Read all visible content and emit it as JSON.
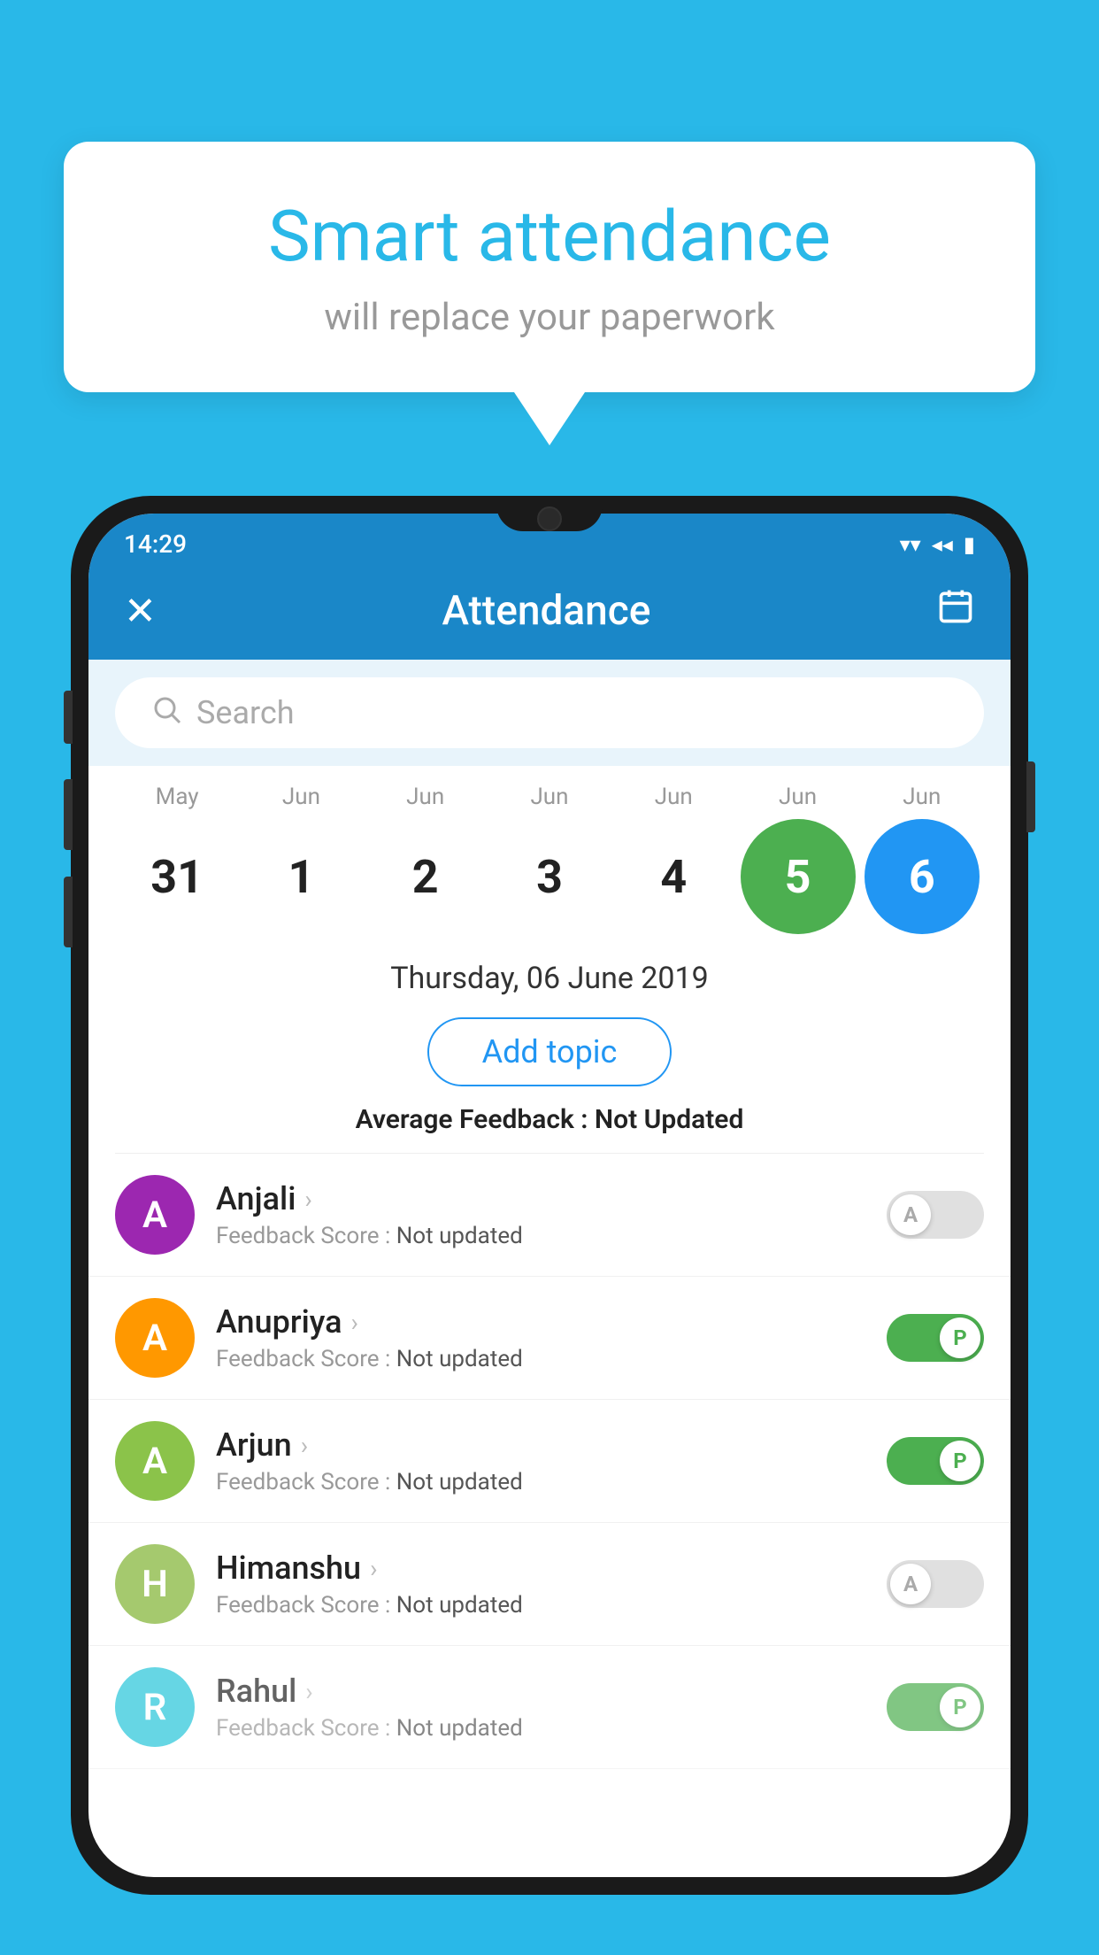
{
  "background_color": "#29b8e8",
  "speech_bubble": {
    "title": "Smart attendance",
    "subtitle": "will replace your paperwork"
  },
  "status_bar": {
    "time": "14:29",
    "wifi_icon": "▼",
    "signal_icon": "◀",
    "battery_icon": "▮"
  },
  "header": {
    "title": "Attendance",
    "close_label": "✕",
    "calendar_icon": "📅"
  },
  "search": {
    "placeholder": "Search"
  },
  "calendar": {
    "months": [
      "May",
      "Jun",
      "Jun",
      "Jun",
      "Jun",
      "Jun",
      "Jun"
    ],
    "dates": [
      "31",
      "1",
      "2",
      "3",
      "4",
      "5",
      "6"
    ],
    "states": [
      "normal",
      "normal",
      "normal",
      "normal",
      "normal",
      "today",
      "selected"
    ]
  },
  "date_info": {
    "date_label": "Thursday, 06 June 2019",
    "add_topic_label": "Add topic",
    "avg_feedback_label": "Average Feedback :",
    "avg_feedback_value": "Not Updated"
  },
  "students": [
    {
      "name": "Anjali",
      "initial": "A",
      "avatar_color": "#9c27b0",
      "feedback_label": "Feedback Score :",
      "feedback_value": "Not updated",
      "attendance": "absent",
      "toggle_label": "A"
    },
    {
      "name": "Anupriya",
      "initial": "A",
      "avatar_color": "#ff9800",
      "feedback_label": "Feedback Score :",
      "feedback_value": "Not updated",
      "attendance": "present",
      "toggle_label": "P"
    },
    {
      "name": "Arjun",
      "initial": "A",
      "avatar_color": "#8bc34a",
      "feedback_label": "Feedback Score :",
      "feedback_value": "Not updated",
      "attendance": "present",
      "toggle_label": "P"
    },
    {
      "name": "Himanshu",
      "initial": "H",
      "avatar_color": "#a5c96e",
      "feedback_label": "Feedback Score :",
      "feedback_value": "Not updated",
      "attendance": "absent",
      "toggle_label": "A"
    },
    {
      "name": "Rahul",
      "initial": "R",
      "avatar_color": "#26c6da",
      "feedback_label": "Feedback Score :",
      "feedback_value": "Not updated",
      "attendance": "present",
      "toggle_label": "P"
    }
  ]
}
